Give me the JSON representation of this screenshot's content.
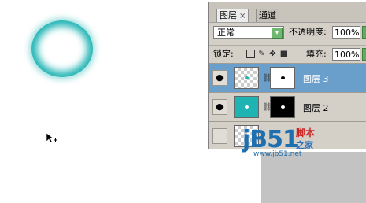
{
  "layers_panel": {
    "tabs": [
      {
        "label": "图层",
        "close": "×"
      },
      {
        "label": "通道"
      }
    ],
    "blend_mode": "正常",
    "opacity_label": "不透明度:",
    "opacity_value": "100%",
    "lock_label": "锁定:",
    "fill_label": "填充:",
    "fill_value": "100%",
    "layers": [
      {
        "name": "图层 3",
        "selected": true
      },
      {
        "name": "图层 2",
        "selected": false
      }
    ]
  },
  "watermark": {
    "logo": "jB51",
    "chars_top": "脚本",
    "chars_bottom": "之家",
    "url": "www.jb51.net"
  },
  "colors": {
    "ring": "#1fb3b3",
    "selected_layer": "#6a9fcc",
    "panel_bg": "#d4d0c8"
  }
}
